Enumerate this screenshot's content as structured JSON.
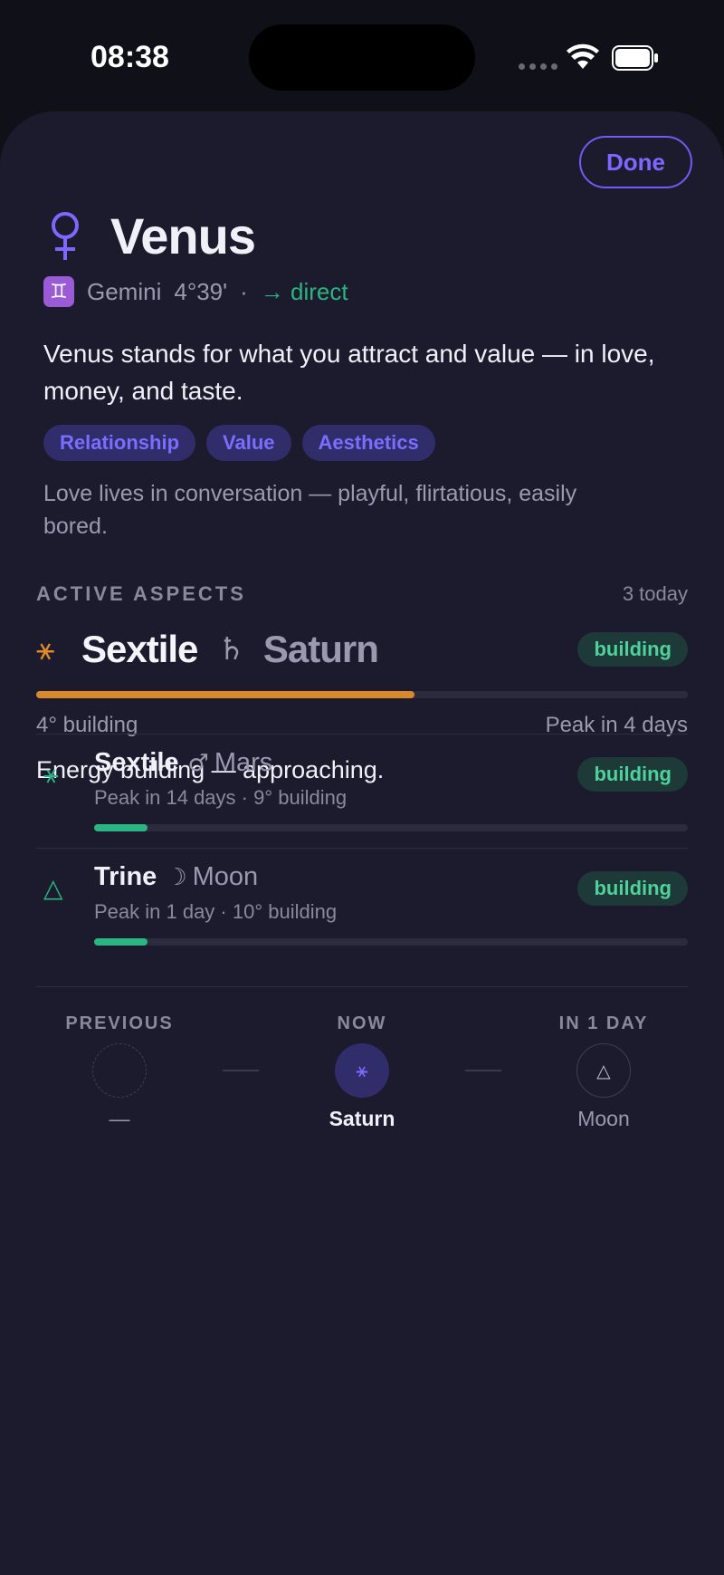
{
  "status_bar": {
    "time": "08:38"
  },
  "sheet": {
    "done_label": "Done",
    "planet": {
      "glyph": "venus-symbol",
      "name": "Venus",
      "sign_badge": "♊",
      "sign": "Gemini",
      "degree": "4°39'",
      "separator": "·",
      "motion": "→ direct"
    },
    "description": "Venus stands for what you attract and value — in love, money, and taste.",
    "tags": [
      "Relationship",
      "Value",
      "Aesthetics"
    ],
    "note": "Love lives in conversation — playful, flirtatious, easily bored.",
    "active_aspects": {
      "title": "ACTIVE ASPECTS",
      "count": "3 today",
      "featured": {
        "aspect_glyph": "⚹",
        "aspect": "Sextile",
        "planet_glyph": "♄",
        "planet": "Saturn",
        "status": "building",
        "progress": 0.58,
        "orb": "4° building",
        "peak": "Peak in 4 days",
        "summary": "Energy building — approaching.",
        "accent_color": "#D88A2A"
      },
      "list": [
        {
          "aspect_glyph": "⚹",
          "aspect": "Sextile",
          "planet_glyph": "♂",
          "planet": "Mars",
          "detail": "Peak in 14 days · 9° building",
          "status": "building",
          "progress": 0.09
        },
        {
          "aspect_glyph": "△",
          "aspect": "Trine",
          "planet_glyph": "☽",
          "planet": "Moon",
          "detail": "Peak in 1 day · 10° building",
          "status": "building",
          "progress": 0.09
        }
      ]
    },
    "timeline": {
      "previous": {
        "label": "PREVIOUS",
        "name": "—"
      },
      "now": {
        "label": "NOW",
        "glyph": "⚹",
        "name": "Saturn"
      },
      "next": {
        "label": "IN 1 DAY",
        "glyph": "△",
        "name": "Moon"
      }
    }
  },
  "colors": {
    "accent": "#7B68FF",
    "positive": "#2BB582",
    "warning": "#D88A2A",
    "sheet_bg": "#1C1B2E"
  }
}
